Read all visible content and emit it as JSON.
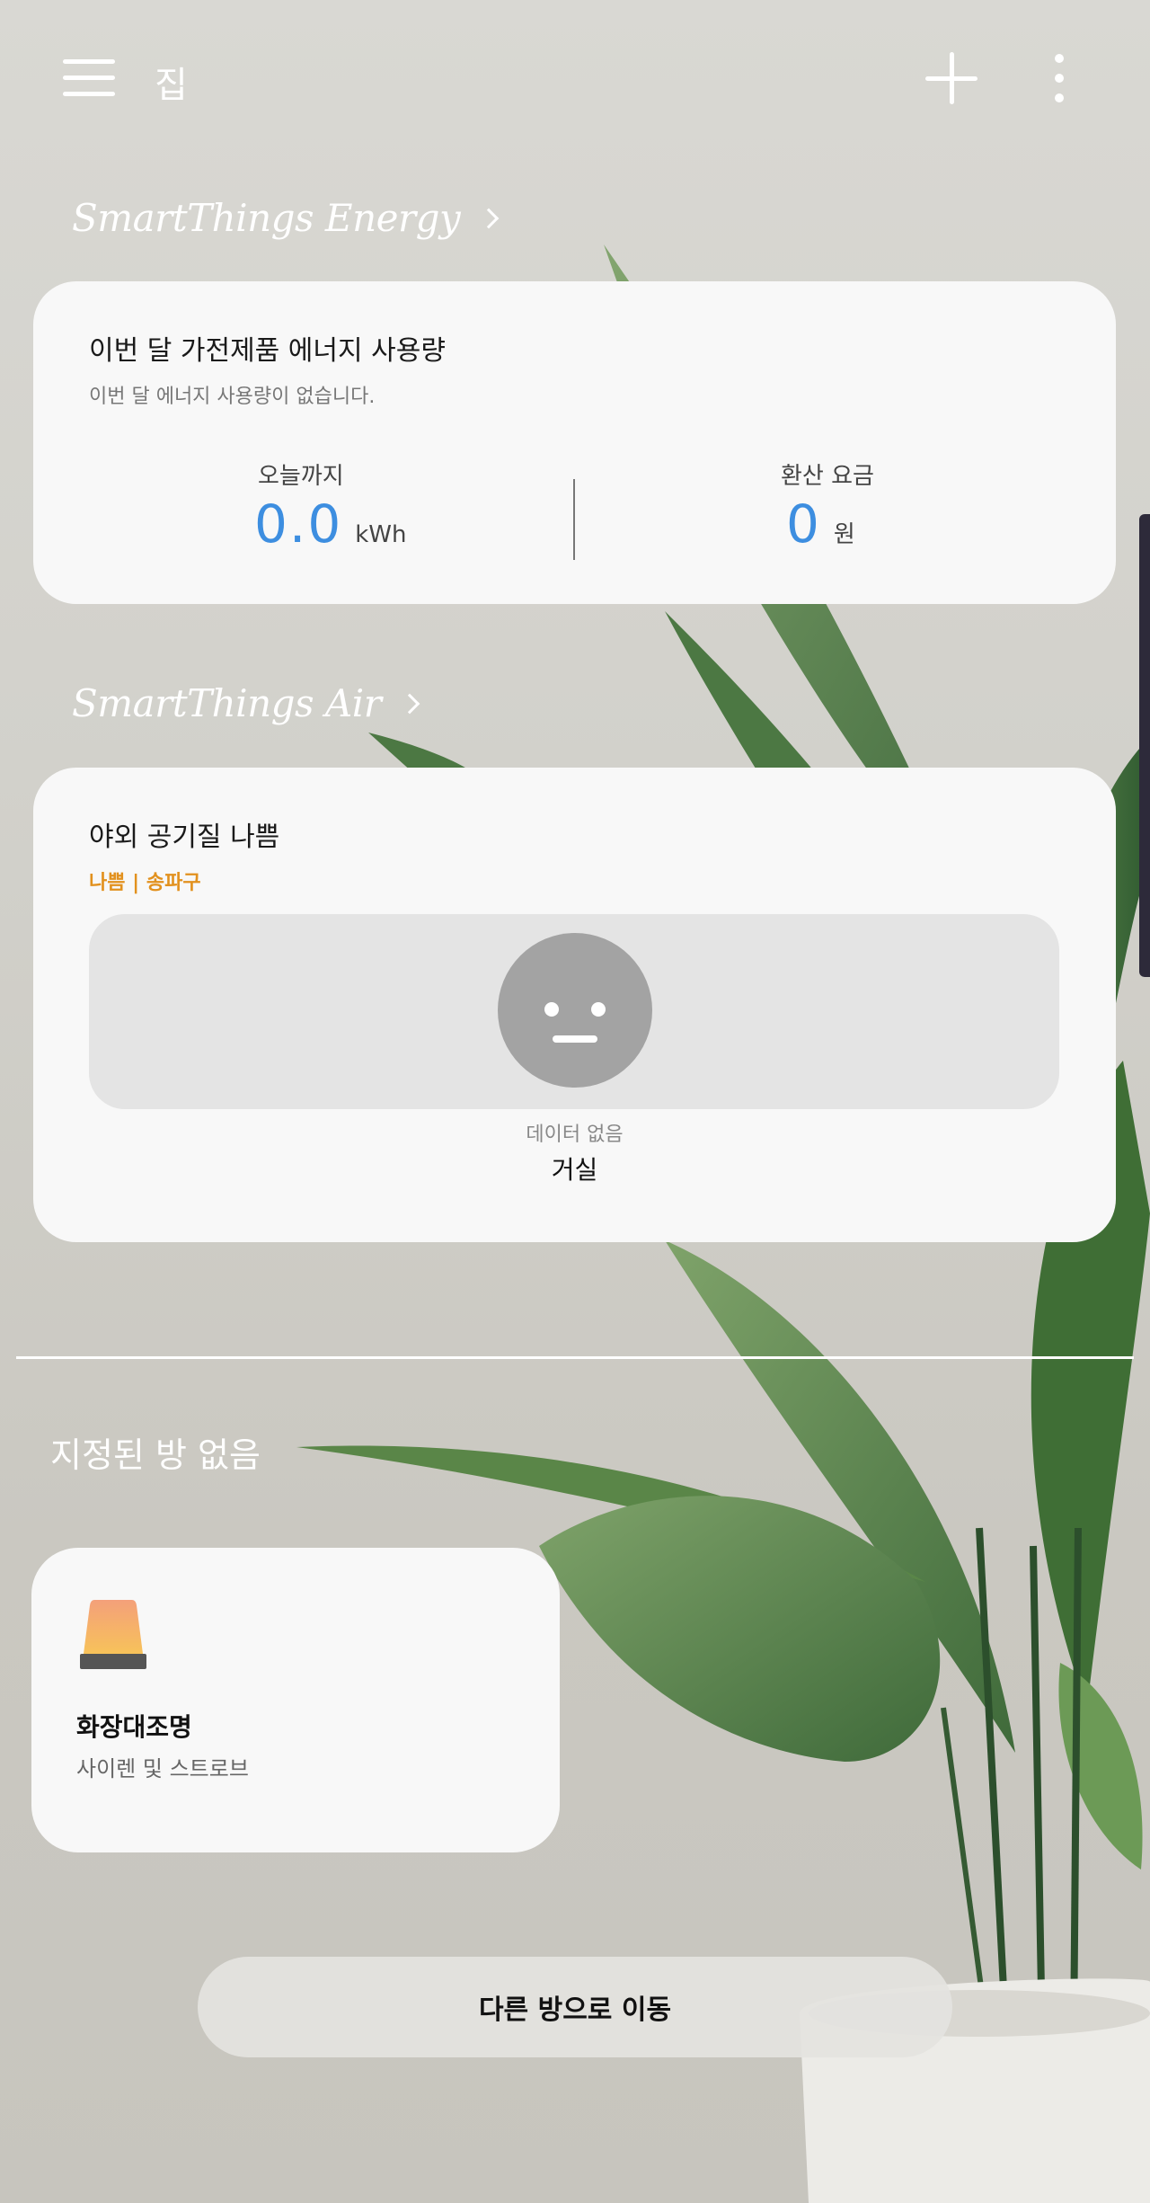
{
  "header": {
    "title": "집",
    "menu_icon": "hamburger-menu-icon",
    "add_icon": "plus-icon",
    "more_icon": "more-vertical-icon"
  },
  "energy": {
    "section_label": "SmartThings Energy",
    "card_title": "이번 달 가전제품 에너지 사용량",
    "card_subtitle": "이번 달 에너지 사용량이 없습니다.",
    "usage_label": "오늘까지",
    "usage_value": "0.0",
    "usage_unit": "kWh",
    "cost_label": "환산 요금",
    "cost_value": "0",
    "cost_unit": "원"
  },
  "air": {
    "section_label": "SmartThings Air",
    "card_title": "야외 공기질 나쁨",
    "status": "나쁨 | 송파구",
    "face_icon": "neutral-face-icon",
    "no_data": "데이터 없음",
    "room": "거실"
  },
  "rooms": {
    "unassigned_label": "지정된 방 없음",
    "devices": [
      {
        "name": "화장대조명",
        "status": "사이렌 및 스트로브",
        "icon": "siren-light-icon"
      }
    ],
    "move_button": "다른 방으로 이동"
  },
  "colors": {
    "accent_blue": "#3d8ee0",
    "warning_orange": "#e2911e",
    "card_bg": "#f8f8f8"
  }
}
